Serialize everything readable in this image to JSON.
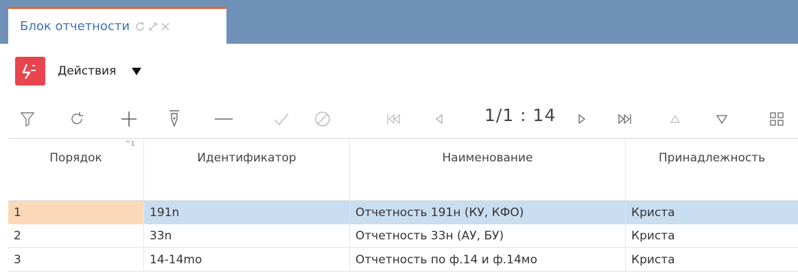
{
  "tab": {
    "title": "Блок отчетности"
  },
  "actions": {
    "label": "Действия"
  },
  "pager": {
    "text": "1/1 : 14"
  },
  "grid": {
    "columns": [
      "Порядок",
      "Идентификатор",
      "Наименование",
      "Принадлежность"
    ],
    "sort_indicator": "^1",
    "rows": [
      {
        "order": "1",
        "id": "191n",
        "name": "Отчетность 191н (КУ, КФО)",
        "owner": "Криста"
      },
      {
        "order": "2",
        "id": "33n",
        "name": "Отчетность 33н (АУ, БУ)",
        "owner": "Криста"
      },
      {
        "order": "3",
        "id": "14-14mo",
        "name": "Отчетность по ф.14 и ф.14мо",
        "owner": "Криста"
      }
    ]
  },
  "colors": {
    "tabbar": "#6f91b8",
    "accent": "#e8602c",
    "logo": "#e8444e",
    "selected_row": "#c9ddf1",
    "selected_order": "#fbd9b8"
  }
}
